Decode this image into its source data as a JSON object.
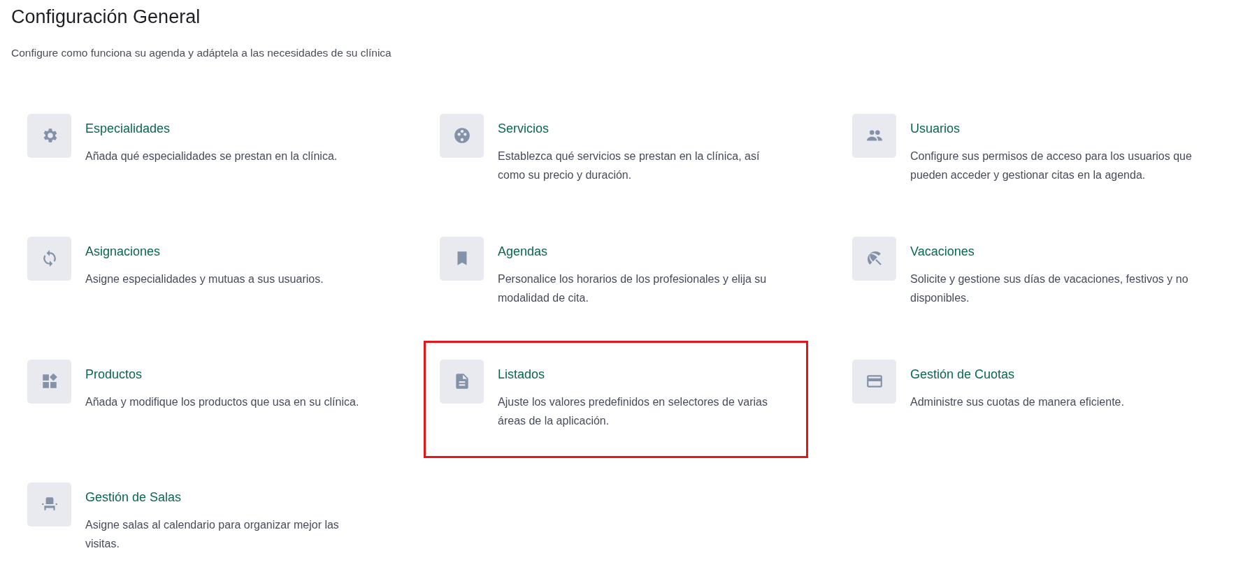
{
  "page": {
    "title": "Configuración General",
    "subtitle": "Configure como funciona su agenda y adáptela a las necesidades de su clínica"
  },
  "settings": [
    {
      "title": "Especialidades",
      "description": "Añada qué especialidades se prestan en la clínica.",
      "highlighted": false
    },
    {
      "title": "Servicios",
      "description": "Establezca qué servicios se prestan en la clínica, así como su precio y duración.",
      "highlighted": false
    },
    {
      "title": "Usuarios",
      "description": "Configure sus permisos de acceso para los usuarios que pueden acceder y gestionar citas en la agenda.",
      "highlighted": false
    },
    {
      "title": "Asignaciones",
      "description": "Asigne especialidades y mutuas a sus usuarios.",
      "highlighted": false
    },
    {
      "title": "Agendas",
      "description": "Personalice los horarios de los profesionales y elija su modalidad de cita.",
      "highlighted": false
    },
    {
      "title": "Vacaciones",
      "description": "Solicite y gestione sus días de vacaciones, festivos y no disponibles.",
      "highlighted": false
    },
    {
      "title": "Productos",
      "description": "Añada y modifique los productos que usa en su clínica.",
      "highlighted": false
    },
    {
      "title": "Listados",
      "description": "Ajuste los valores predefinidos en selectores de varias áreas de la aplicación.",
      "highlighted": true
    },
    {
      "title": "Gestión de Cuotas",
      "description": "Administre sus cuotas de manera eficiente.",
      "highlighted": false
    },
    {
      "title": "Gestión de Salas",
      "description": "Asigne salas al calendario para organizar mejor las visitas.",
      "highlighted": false
    }
  ]
}
